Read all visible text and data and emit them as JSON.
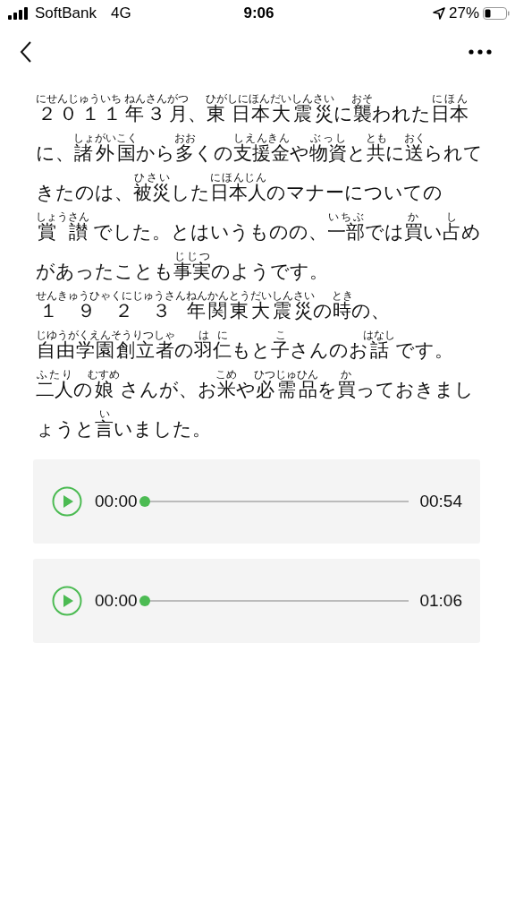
{
  "status_bar": {
    "carrier": "SoftBank",
    "network": "4G",
    "time": "9:06",
    "battery": "27%"
  },
  "article": {
    "segments": [
      {
        "text": "２０１１年３月",
        "ruby": "にせんじゅういち ねんさんがつ"
      },
      {
        "text": "、"
      },
      {
        "text": "東 日本",
        "ruby": "ひがしにほん"
      },
      {
        "text": "大震災",
        "ruby": "だいしんさい"
      },
      {
        "text": "に"
      },
      {
        "text": "襲",
        "ruby": "おそ"
      },
      {
        "text": "われた"
      },
      {
        "text": "日本",
        "ruby": "にほん"
      },
      {
        "text": "に、"
      },
      {
        "text": "諸",
        "ruby": "しょ"
      },
      {
        "text": "外国",
        "ruby": "がいこく"
      },
      {
        "text": "から"
      },
      {
        "text": "多",
        "ruby": "おお"
      },
      {
        "text": "くの"
      },
      {
        "text": "支援金",
        "ruby": "しえんきん"
      },
      {
        "text": "や"
      },
      {
        "text": "物資",
        "ruby": "ぶっし"
      },
      {
        "text": "と"
      },
      {
        "text": "共",
        "ruby": "とも"
      },
      {
        "text": "に"
      },
      {
        "text": "送",
        "ruby": "おく"
      },
      {
        "text": "られてきたのは、"
      },
      {
        "text": "被災",
        "ruby": "ひさい"
      },
      {
        "text": "した"
      },
      {
        "text": "日本人",
        "ruby": "にほんじん"
      },
      {
        "text": "のマナーについての"
      },
      {
        "text": "賞 讃",
        "ruby": "しょうさん"
      },
      {
        "text": " でした。とはいうものの、"
      },
      {
        "text": "一部",
        "ruby": "いちぶ"
      },
      {
        "text": "では"
      },
      {
        "text": "買",
        "ruby": "か"
      },
      {
        "text": "い"
      },
      {
        "text": "占",
        "ruby": "し"
      },
      {
        "text": "めがあったことも"
      },
      {
        "text": "事実",
        "ruby": "じじつ"
      },
      {
        "text": "のようです。"
      },
      {
        "text": "１ ９ ２ ３ ",
        "ruby": "せんきゅうひゃくにじゅうさん"
      },
      {
        "text": "年",
        "ruby": "ねん"
      },
      {
        "text": "関東大震災",
        "ruby": "かんとうだいしんさい"
      },
      {
        "text": "の"
      },
      {
        "text": "時",
        "ruby": "とき"
      },
      {
        "text": "の、"
      },
      {
        "text": "自由学園創立者",
        "ruby": "じゆうがくえんそうりつしゃ"
      },
      {
        "text": "の"
      },
      {
        "text": "羽仁",
        "ruby": "はに"
      },
      {
        "text": "もと"
      },
      {
        "text": "子",
        "ruby": "こ"
      },
      {
        "text": "さんのお"
      },
      {
        "text": "話",
        "ruby": "はなし"
      },
      {
        "text": " です。"
      },
      {
        "text": "二人",
        "ruby": "ふたり"
      },
      {
        "text": "の"
      },
      {
        "text": "娘",
        "ruby": "むすめ"
      },
      {
        "text": " さんが、お"
      },
      {
        "text": "米",
        "ruby": "こめ"
      },
      {
        "text": "や"
      },
      {
        "text": "必需品",
        "ruby": "ひつじゅひん"
      },
      {
        "text": "を"
      },
      {
        "text": "買",
        "ruby": "か"
      },
      {
        "text": "っておきましょうと"
      },
      {
        "text": "言",
        "ruby": "い"
      },
      {
        "text": "いました。"
      }
    ]
  },
  "players": [
    {
      "current": "00:00",
      "duration": "00:54",
      "level": 0
    },
    {
      "current": "00:00",
      "duration": "01:06",
      "level": 0
    }
  ]
}
